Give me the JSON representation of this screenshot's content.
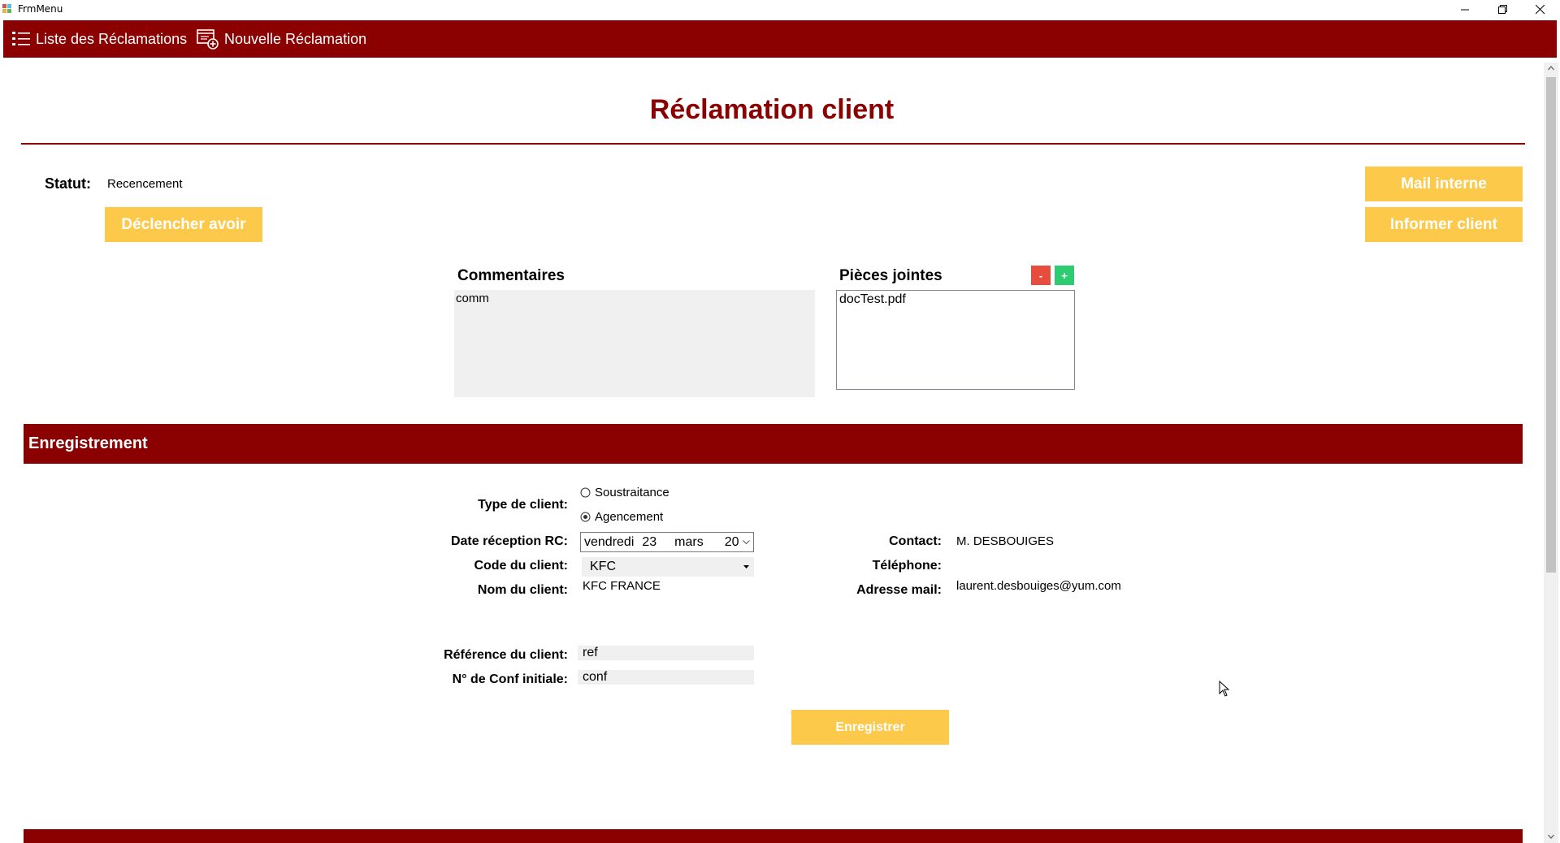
{
  "window": {
    "title": "FrmMenu"
  },
  "menu": {
    "list_label": "Liste des Réclamations",
    "new_label": "Nouvelle Réclamation"
  },
  "page": {
    "title": "Réclamation client"
  },
  "status": {
    "label": "Statut:",
    "value": "Recencement"
  },
  "buttons": {
    "declencher_avoir": "Déclencher avoir",
    "mail_interne": "Mail interne",
    "informer_client": "Informer client",
    "enregistrer": "Enregistrer",
    "remove_attachment": "-",
    "add_attachment": "+"
  },
  "comments": {
    "label": "Commentaires",
    "value": "comm"
  },
  "attachments": {
    "label": "Pièces jointes",
    "items": [
      "docTest.pdf"
    ]
  },
  "section": {
    "title": "Enregistrement"
  },
  "form": {
    "type_client_label": "Type de client:",
    "type_options": [
      {
        "label": "Soustraitance",
        "checked": false
      },
      {
        "label": "Agencement",
        "checked": true
      }
    ],
    "date_label": "Date réception RC:",
    "date_day_name": "vendredi",
    "date_day": "23",
    "date_month": "mars",
    "date_year": "20",
    "code_label": "Code du client:",
    "code_value": "KFC",
    "nom_label": "Nom du client:",
    "nom_value": "KFC FRANCE",
    "ref_label": "Référence du client:",
    "ref_value": "ref",
    "conf_label": "N° de Conf initiale:",
    "conf_value": "conf",
    "contact_label": "Contact:",
    "contact_value": "M. DESBOUIGES",
    "tel_label": "Téléphone:",
    "tel_value": "",
    "mail_label": "Adresse mail:",
    "mail_value": "laurent.desbouiges@yum.com"
  },
  "colors": {
    "brand": "#8b0000",
    "button": "#fdc94a",
    "remove": "#e74c3c",
    "add": "#2ecc71"
  }
}
